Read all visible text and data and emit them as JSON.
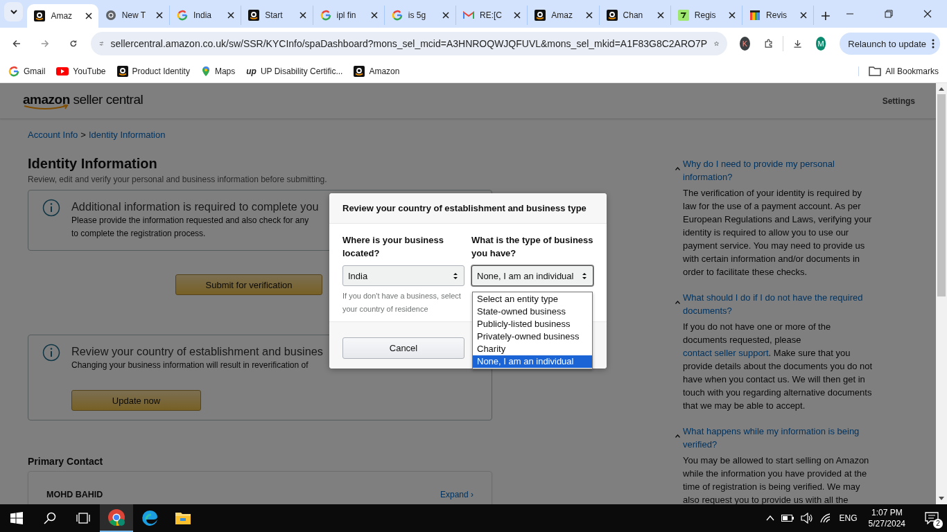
{
  "browser": {
    "tabs": [
      {
        "title": "Amaz",
        "selected": true
      },
      {
        "title": "New T",
        "selected": false
      },
      {
        "title": "India",
        "selected": false
      },
      {
        "title": "Start",
        "selected": false
      },
      {
        "title": "ipl fin",
        "selected": false
      },
      {
        "title": "is 5g",
        "selected": false
      },
      {
        "title": "RE:[C",
        "selected": false
      },
      {
        "title": "Amaz",
        "selected": false
      },
      {
        "title": "Chan",
        "selected": false
      },
      {
        "title": "Regis",
        "selected": false
      },
      {
        "title": "Revis",
        "selected": false
      }
    ],
    "address": "sellercentral.amazon.co.uk/sw/SSR/KYCInfo/spaDashboard?mons_sel_mcid=A3HNROQWJQFUVL&mons_sel_mkid=A1F83G8C2ARO7P",
    "extension_initial": "K",
    "profile_initial": "M",
    "relaunch": "Relaunch to update",
    "bookmarks": [
      {
        "label": "Gmail"
      },
      {
        "label": "YouTube"
      },
      {
        "label": "Product Identity"
      },
      {
        "label": "Maps"
      },
      {
        "label": "UP Disability Certific...",
        "logo_text": "up"
      },
      {
        "label": "Amazon"
      }
    ],
    "all_bookmarks": "All Bookmarks"
  },
  "page": {
    "logo_word": "amazon",
    "logo_rest": "seller central",
    "settings": "Settings",
    "breadcrumb": [
      "Account Info",
      "Identity Information"
    ],
    "breadcrumb_separator": ">",
    "title": "Identity Information",
    "subtitle": "Review, edit and verify your personal and business information before submitting.",
    "alerts": [
      {
        "heading": "Additional information is required to complete you",
        "body": [
          "Please provide the information requested and also check for any",
          "to complete the registration process."
        ]
      },
      {
        "heading": "Review your country of establishment and busines",
        "body": [
          "Changing your business information will result in reverification of"
        ]
      }
    ],
    "submit_button": "Submit for verification",
    "update_button": "Update now",
    "primary_contact": {
      "heading": "Primary Contact",
      "name": "MOHD BAHID",
      "expand": "Expand ›"
    },
    "faq": [
      {
        "question": "Why do I need to provide my personal information?",
        "expanded": true,
        "answer": [
          {
            "kind": "text",
            "text": "The verification of your identity is required by law for the use of a payment account. As per European Regulations and Laws, verifying your identity is required to allow you to use our payment service. You may need to provide us with certain information and/or documents in order to facilitate these checks."
          }
        ]
      },
      {
        "question": "What should I do if I do not have the required documents?",
        "expanded": true,
        "answer": [
          {
            "kind": "text",
            "text": "If you do not have one or more of the documents requested, please "
          },
          {
            "kind": "link",
            "text": "contact seller support"
          },
          {
            "kind": "text",
            "text": ". Make sure that you provide details about the documents you do not have when you contact us. We will then get in touch with you regarding alternative documents that we may be able to accept."
          }
        ]
      },
      {
        "question": "What happens while my information is being verified?",
        "expanded": true,
        "answer": [
          {
            "kind": "text",
            "text": "You may be allowed to start selling on Amazon while the information you have provided at the time of registration is being verified. We may also request you to provide us with all the"
          }
        ]
      }
    ]
  },
  "modal": {
    "title": "Review your country of establishment and business type",
    "fields": [
      {
        "label": "Where is your business located?",
        "value": "India",
        "hint": "If you don't have a business, select your country of residence",
        "open": false
      },
      {
        "label": "What is the type of business you have?",
        "value": "None, I am an individual",
        "open": true,
        "options": [
          {
            "label": "Select an entity type",
            "selected": false
          },
          {
            "label": "State-owned business",
            "selected": false
          },
          {
            "label": "Publicly-listed business",
            "selected": false
          },
          {
            "label": "Privately-owned business",
            "selected": false
          },
          {
            "label": "Charity",
            "selected": false
          },
          {
            "label": "None, I am an individual",
            "selected": true
          }
        ]
      }
    ],
    "cancel": "Cancel"
  },
  "taskbar": {
    "language": "ENG",
    "time": "1:07 PM",
    "date": "5/27/2024",
    "notifications": "2"
  }
}
